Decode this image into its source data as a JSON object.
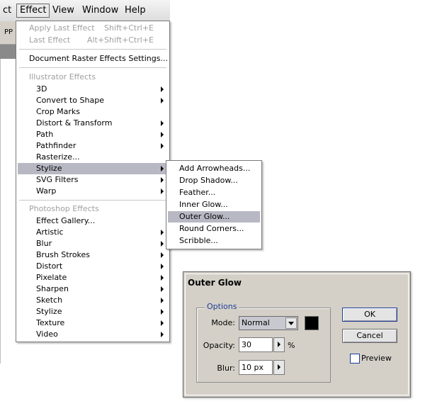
{
  "menubar": {
    "items": [
      "ct",
      "Effect",
      "View",
      "Window",
      "Help"
    ],
    "toolbar_text": "PP"
  },
  "effect_menu": {
    "apply_last": {
      "label": "Apply Last Effect",
      "shortcut": "Shift+Ctrl+E"
    },
    "last": {
      "label": "Last Effect",
      "shortcut": "Alt+Shift+Ctrl+E"
    },
    "doc_raster": "Document Raster Effects Settings...",
    "illustrator_header": "Illustrator Effects",
    "illustrator_items": [
      "3D",
      "Convert to Shape",
      "Crop Marks",
      "Distort & Transform",
      "Path",
      "Pathfinder",
      "Rasterize...",
      "Stylize",
      "SVG Filters",
      "Warp"
    ],
    "photoshop_header": "Photoshop Effects",
    "photoshop_items": [
      "Effect Gallery...",
      "Artistic",
      "Blur",
      "Brush Strokes",
      "Distort",
      "Pixelate",
      "Sharpen",
      "Sketch",
      "Stylize",
      "Texture",
      "Video"
    ]
  },
  "stylize_menu": {
    "items": [
      "Add Arrowheads...",
      "Drop Shadow...",
      "Feather...",
      "Inner Glow...",
      "Outer Glow...",
      "Round Corners...",
      "Scribble..."
    ]
  },
  "dialog": {
    "title": "Outer Glow",
    "options_legend": "Options",
    "mode_label": "Mode:",
    "mode_value": "Normal",
    "opacity_label": "Opacity:",
    "opacity_value": "30",
    "opacity_unit": "%",
    "blur_label": "Blur:",
    "blur_value": "10 px",
    "ok_label": "OK",
    "cancel_label": "Cancel",
    "preview_label": "Preview",
    "glow_color": "#000000"
  },
  "colors": {
    "highlight": "#b8b8c4",
    "dialog_bg": "#d4d0c8",
    "accent": "#1e3c96"
  }
}
